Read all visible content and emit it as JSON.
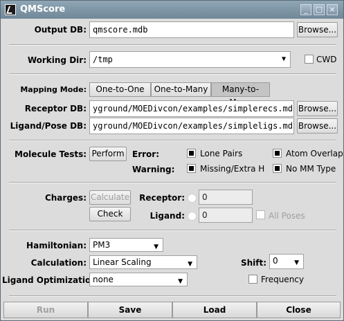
{
  "window": {
    "title": "QMScore"
  },
  "output_db": {
    "label": "Output DB:",
    "value": "qmscore.mdb",
    "browse": "Browse..."
  },
  "working_dir": {
    "label": "Working Dir:",
    "value": "/tmp",
    "cwd_label": "CWD",
    "cwd_checked": false
  },
  "mapping": {
    "label": "Mapping Mode:",
    "options": [
      "One-to-One",
      "One-to-Many",
      "Many-to-Many"
    ],
    "selected": "Many-to-Many"
  },
  "receptor_db": {
    "label": "Receptor DB:",
    "value": "yground/MOEDivcon/examples/simplerecs.mdb",
    "browse": "Browse..."
  },
  "ligand_db": {
    "label": "Ligand/Pose DB:",
    "value": "yground/MOEDivcon/examples/simpleligs.mdb",
    "browse": "Browse..."
  },
  "molecule_tests": {
    "label": "Molecule Tests:",
    "perform": "Perform",
    "error_label": "Error:",
    "warning_label": "Warning:",
    "lone_pairs": "Lone Pairs",
    "atom_overlap": "Atom Overlap",
    "missing_extra_h": "Missing/Extra H",
    "no_mm_type": "No MM Type"
  },
  "charges": {
    "label": "Charges:",
    "calculate": "Calculate",
    "check": "Check",
    "receptor_label": "Receptor:",
    "receptor_value": "0",
    "ligand_label": "Ligand:",
    "ligand_value": "0",
    "all_poses": "All Poses"
  },
  "hamiltonian": {
    "label": "Hamiltonian:",
    "value": "PM3"
  },
  "calculation": {
    "label": "Calculation:",
    "value": "Linear Scaling"
  },
  "shift": {
    "label": "Shift:",
    "value": "0"
  },
  "ligand_opt": {
    "label": "Ligand Optimization:",
    "value": "none",
    "frequency": "Frequency"
  },
  "buttons": {
    "run": "Run",
    "save": "Save",
    "load": "Load",
    "close": "Close"
  }
}
